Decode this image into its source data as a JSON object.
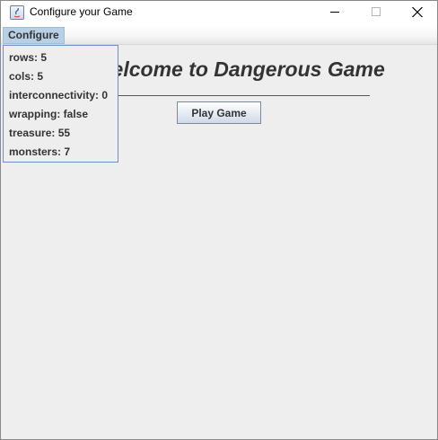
{
  "window": {
    "title": "Configure your Game",
    "controls": [
      "minimize-icon",
      "maximize-icon",
      "close-icon"
    ]
  },
  "menubar": {
    "configure_label": "Configure"
  },
  "dropdown": {
    "items": [
      {
        "label": "rows: 5"
      },
      {
        "label": "cols: 5"
      },
      {
        "label": "interconnectivity: 0"
      },
      {
        "label": "wrapping: false"
      },
      {
        "label": "treasure: 55"
      },
      {
        "label": "monsters: 7"
      }
    ]
  },
  "main": {
    "heading": "Welcome to Dangerous Game",
    "play_button_label": "Play Game"
  },
  "colors": {
    "menu_highlight": "#b8cfe5",
    "dropdown_border": "#6f8fbf",
    "background": "#eeeeee",
    "text": "#333333"
  }
}
